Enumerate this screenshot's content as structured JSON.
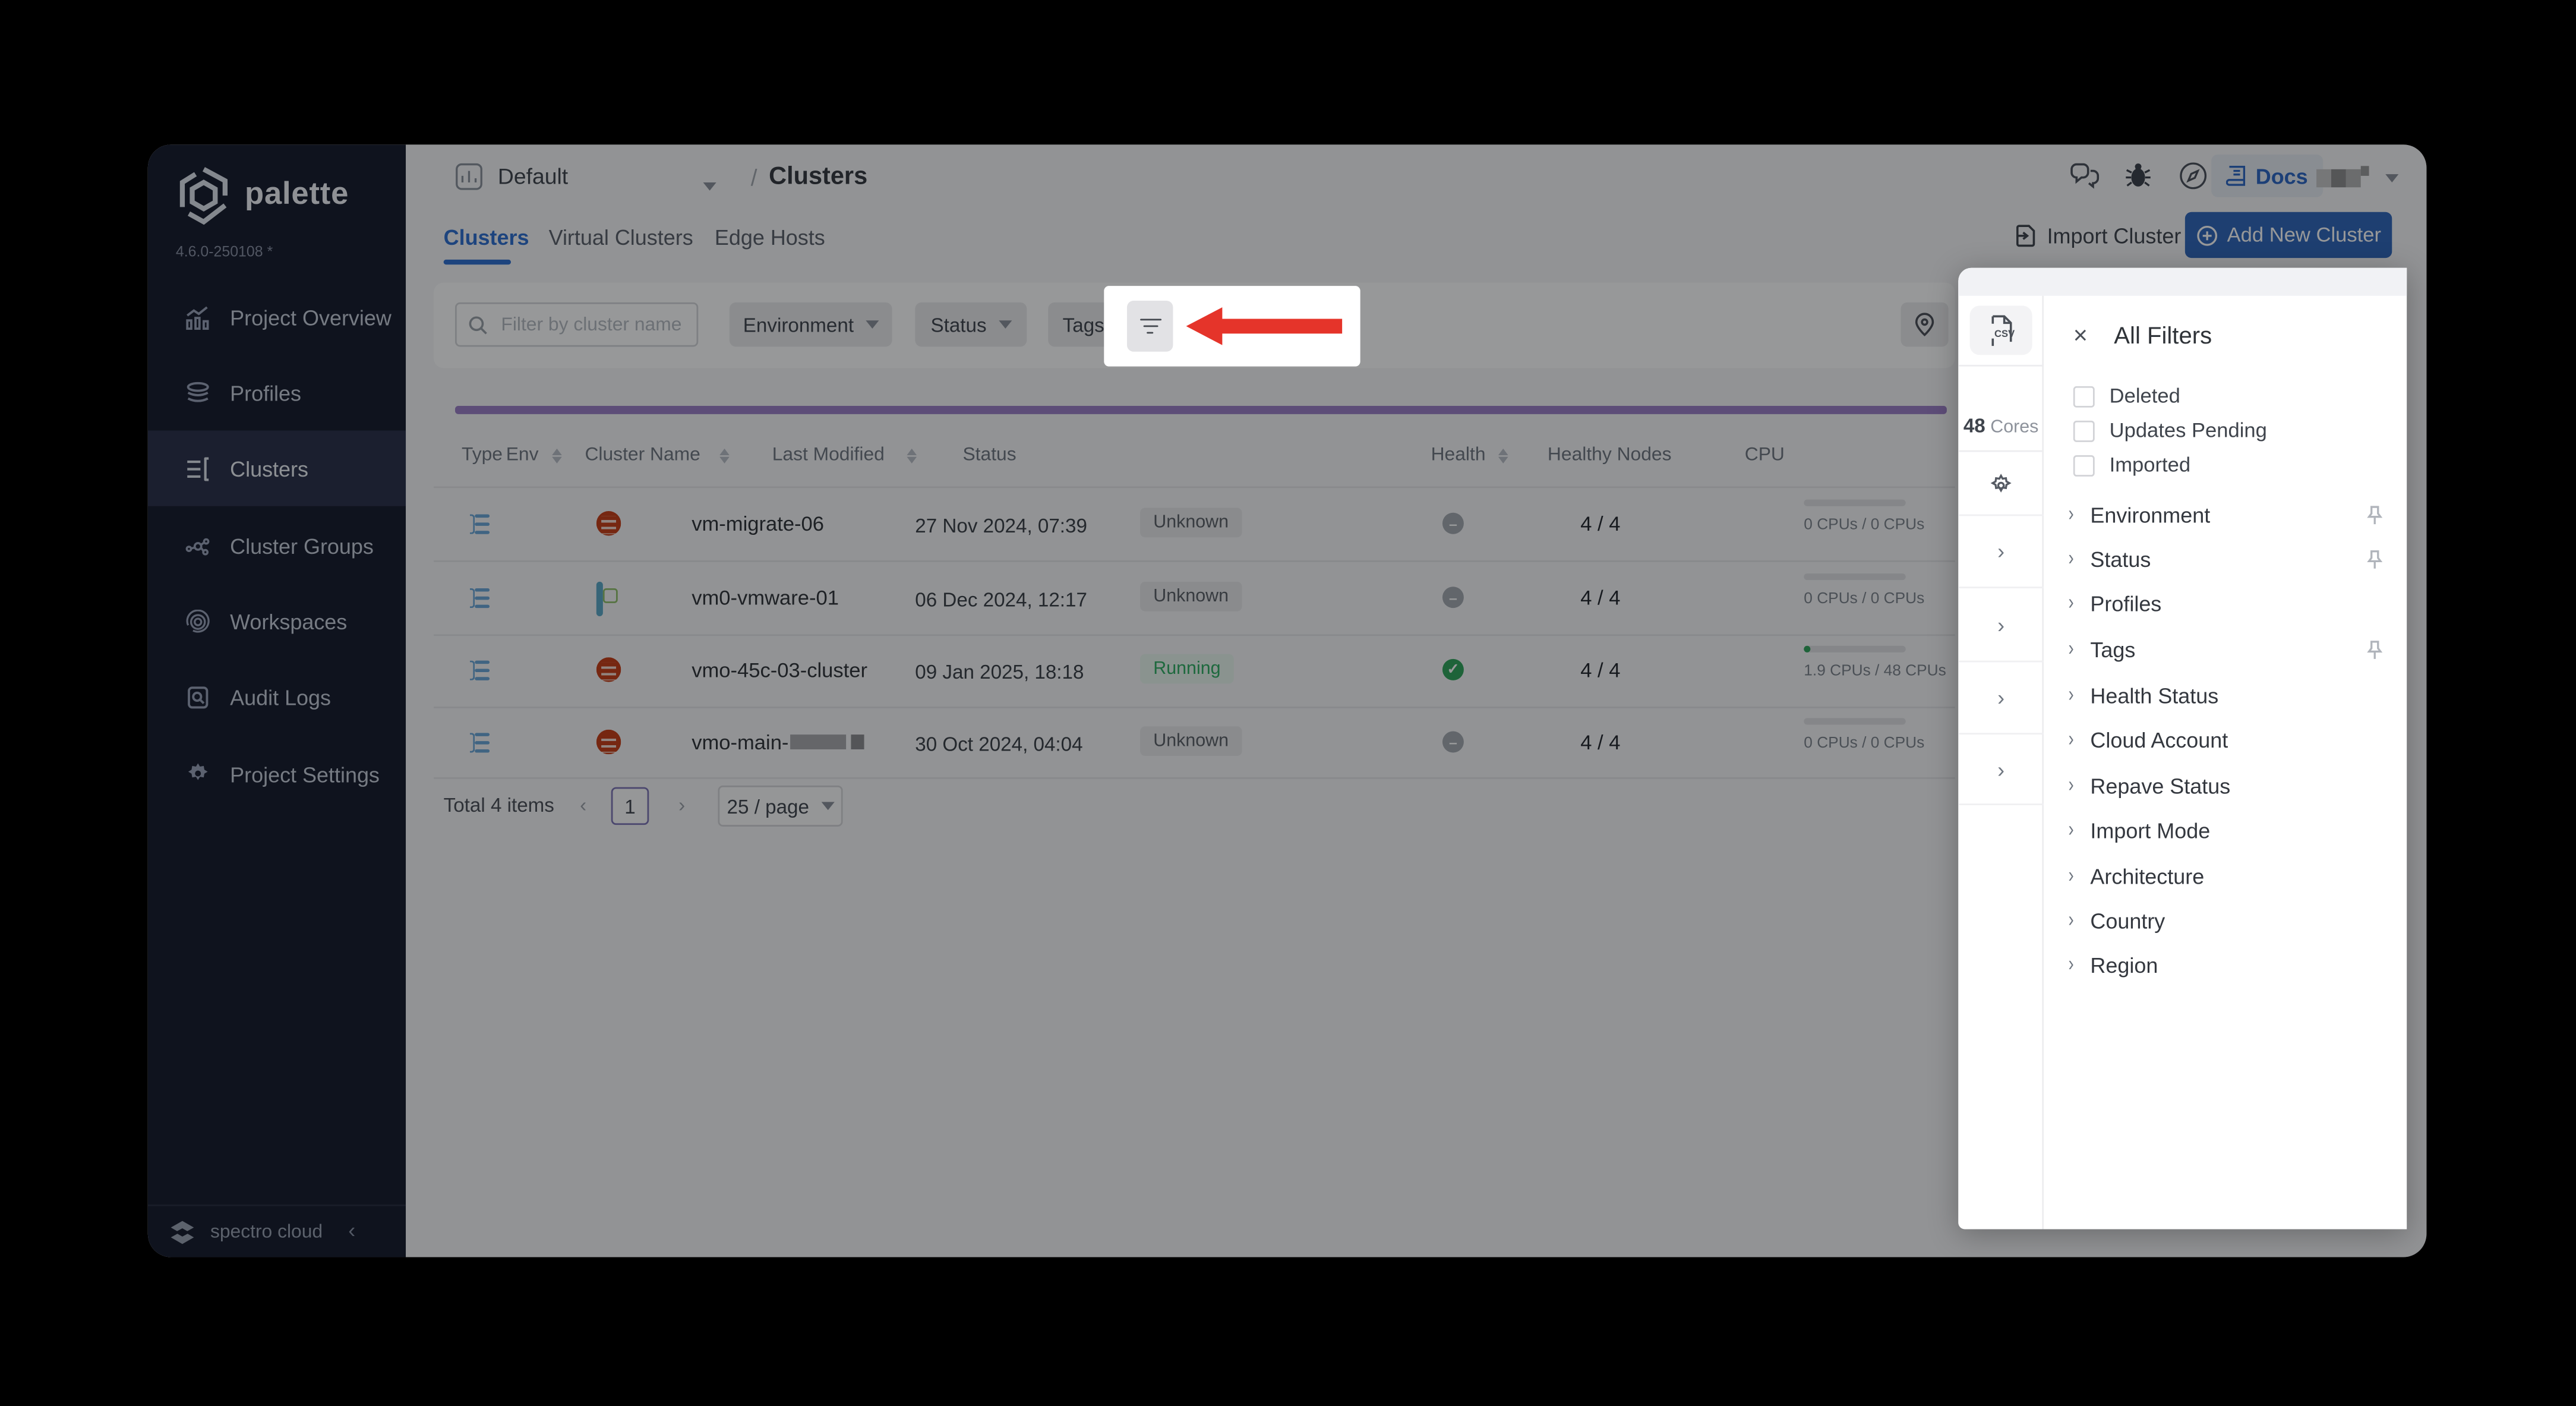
{
  "sidebar": {
    "logo_text": "palette",
    "version": "4.6.0-250108 *",
    "items": [
      {
        "label": "Project Overview"
      },
      {
        "label": "Profiles"
      },
      {
        "label": "Clusters"
      },
      {
        "label": "Cluster Groups"
      },
      {
        "label": "Workspaces"
      },
      {
        "label": "Audit Logs"
      },
      {
        "label": "Project Settings"
      }
    ],
    "footer_brand": "spectro cloud",
    "collapse_icon": "‹"
  },
  "header": {
    "project_selector": "Default",
    "breadcrumb_separator": "/",
    "breadcrumb_current": "Clusters",
    "docs_label": "Docs"
  },
  "tabs": [
    {
      "label": "Clusters"
    },
    {
      "label": "Virtual Clusters"
    },
    {
      "label": "Edge Hosts"
    }
  ],
  "actions": {
    "import_label": "Import Cluster",
    "add_label": "Add New Cluster"
  },
  "filter_bar": {
    "search_placeholder": "Filter by cluster name",
    "dropdowns": [
      {
        "label": "Environment"
      },
      {
        "label": "Status"
      },
      {
        "label": "Tags"
      }
    ]
  },
  "table": {
    "columns": {
      "type": "Type",
      "env": "Env",
      "name": "Cluster Name",
      "modified": "Last Modified",
      "status": "Status",
      "health": "Health",
      "nodes": "Healthy Nodes",
      "cpu": "CPU"
    },
    "rows": [
      {
        "name": "vm-migrate-06",
        "modified": "27 Nov 2024, 07:39",
        "status": "Unknown",
        "nodes": "4 / 4",
        "cpu": "0 CPUs / 0 CPUs"
      },
      {
        "name": "vm0-vmware-01",
        "modified": "06 Dec 2024, 12:17",
        "status": "Unknown",
        "nodes": "4 / 4",
        "cpu": "0 CPUs / 0 CPUs"
      },
      {
        "name": "vmo-45c-03-cluster",
        "modified": "09 Jan 2025, 18:18",
        "status": "Running",
        "nodes": "4 / 4",
        "cpu": "1.9 CPUs / 48 CPUs"
      },
      {
        "name": "vmo-main-",
        "modified": "30 Oct 2024, 04:04",
        "status": "Unknown",
        "nodes": "4 / 4",
        "cpu": "0 CPUs / 0 CPUs"
      }
    ]
  },
  "pagination": {
    "total": "Total 4 items",
    "prev": "‹",
    "page": "1",
    "next": "›",
    "page_size": "25 / page"
  },
  "summary": {
    "cores_value": "48",
    "cores_unit": "Cores",
    "csv_label": "CSV"
  },
  "drawer": {
    "close_icon": "×",
    "title": "All Filters",
    "checkboxes": [
      {
        "label": "Deleted"
      },
      {
        "label": "Updates Pending"
      },
      {
        "label": "Imported"
      }
    ],
    "sections": [
      {
        "label": "Environment"
      },
      {
        "label": "Status"
      },
      {
        "label": "Profiles"
      },
      {
        "label": "Tags"
      },
      {
        "label": "Health Status"
      },
      {
        "label": "Cloud Account"
      },
      {
        "label": "Repave Status"
      },
      {
        "label": "Import Mode"
      },
      {
        "label": "Architecture"
      },
      {
        "label": "Country"
      },
      {
        "label": "Region"
      }
    ]
  },
  "colors": {
    "accent": "#2e6fd0",
    "add_button": "#2f66ba",
    "running_green": "#2fae63",
    "purple_bar": "#9b7fc7",
    "arrow_red": "#e5342a",
    "env_red": "#c63d16",
    "env_teal": "#5aa7c6"
  }
}
